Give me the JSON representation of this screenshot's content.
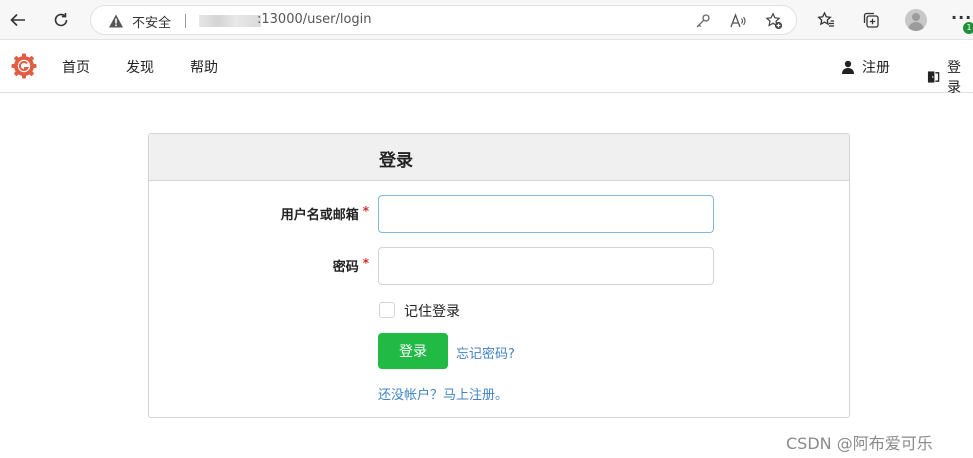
{
  "browser": {
    "insecure_label": "不安全",
    "url": ":13000/user/login",
    "more_label": "···",
    "update_badge": "1",
    "icons": [
      "back-arrow-icon",
      "refresh-icon",
      "warning-icon",
      "key-icon",
      "read-aloud-icon",
      "add-favorite-icon",
      "favorites-icon",
      "collections-icon",
      "profile-icon",
      "more-icon"
    ]
  },
  "nav": {
    "items": [
      {
        "label": "首页"
      },
      {
        "label": "发现"
      },
      {
        "label": "帮助"
      }
    ],
    "register_label": "注册",
    "login_label": "登录",
    "logo_color": "#e05d44"
  },
  "login": {
    "title": "登录",
    "username_label": "用户名或邮箱",
    "password_label": "密码",
    "required_mark": "*",
    "username_value": "",
    "password_value": "",
    "remember_label": "记住登录",
    "remember_checked": false,
    "submit_label": "登录",
    "forgot_link": "忘记密码?",
    "register_link": "还没帐户？马上注册。",
    "accent_color": "#21ba45",
    "link_color": "#4183c4"
  },
  "watermark": "CSDN @阿布爱可乐"
}
